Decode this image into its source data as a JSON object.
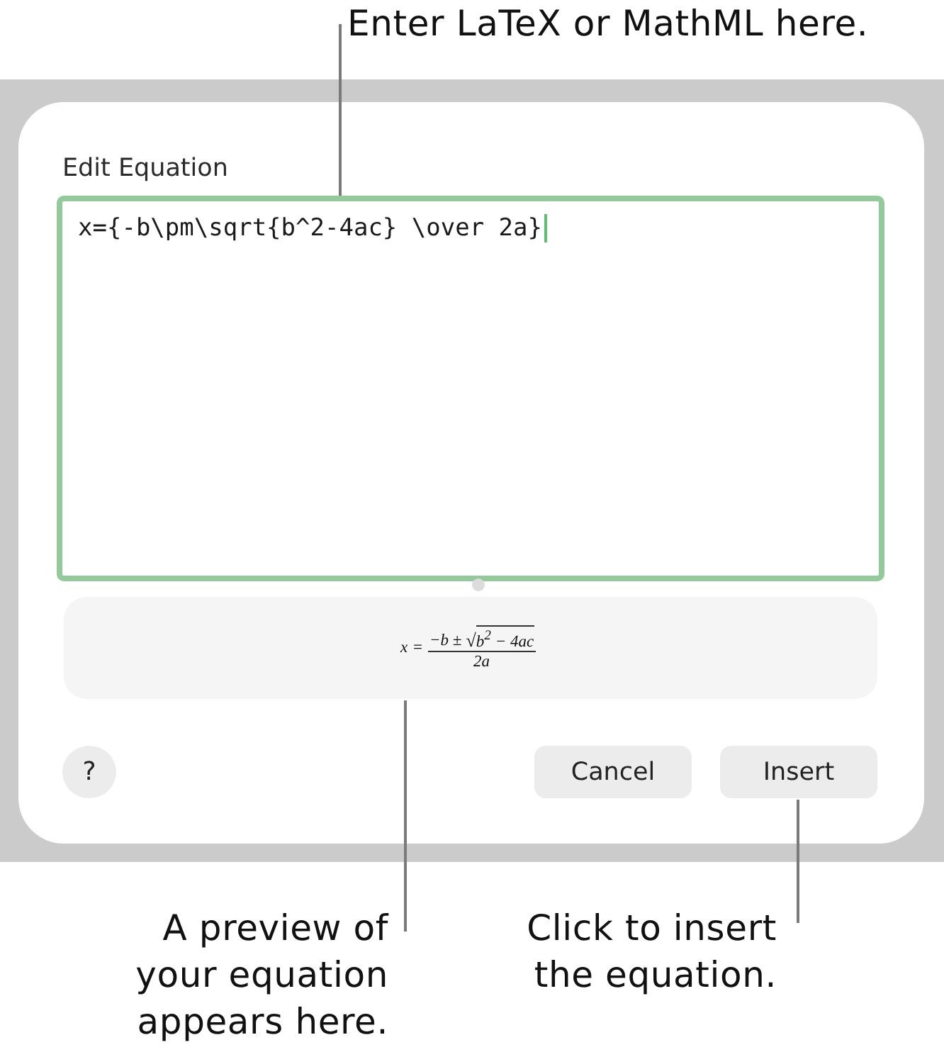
{
  "callout_top": {
    "text": "Enter LaTeX or MathML here."
  },
  "dialog": {
    "title": "Edit Equation",
    "equation_field": {
      "value": "x={-b\\pm\\sqrt{b^2-4ac} \\over 2a}",
      "focused": true
    },
    "preview": {
      "lhs": "x",
      "relation": "=",
      "numerator": "−b ±",
      "radical": "√",
      "radicand": "b$^{2}$ − 4ac",
      "denominator": "2a"
    },
    "help_button": {
      "label": "?"
    },
    "buttons": [
      {
        "label": "Cancel"
      },
      {
        "label": "Insert"
      }
    ]
  },
  "callouts_bottom": [
    {
      "text": "A preview of\nyour equation\nappears here."
    },
    {
      "text": "Click to insert\nthe equation."
    }
  ]
}
